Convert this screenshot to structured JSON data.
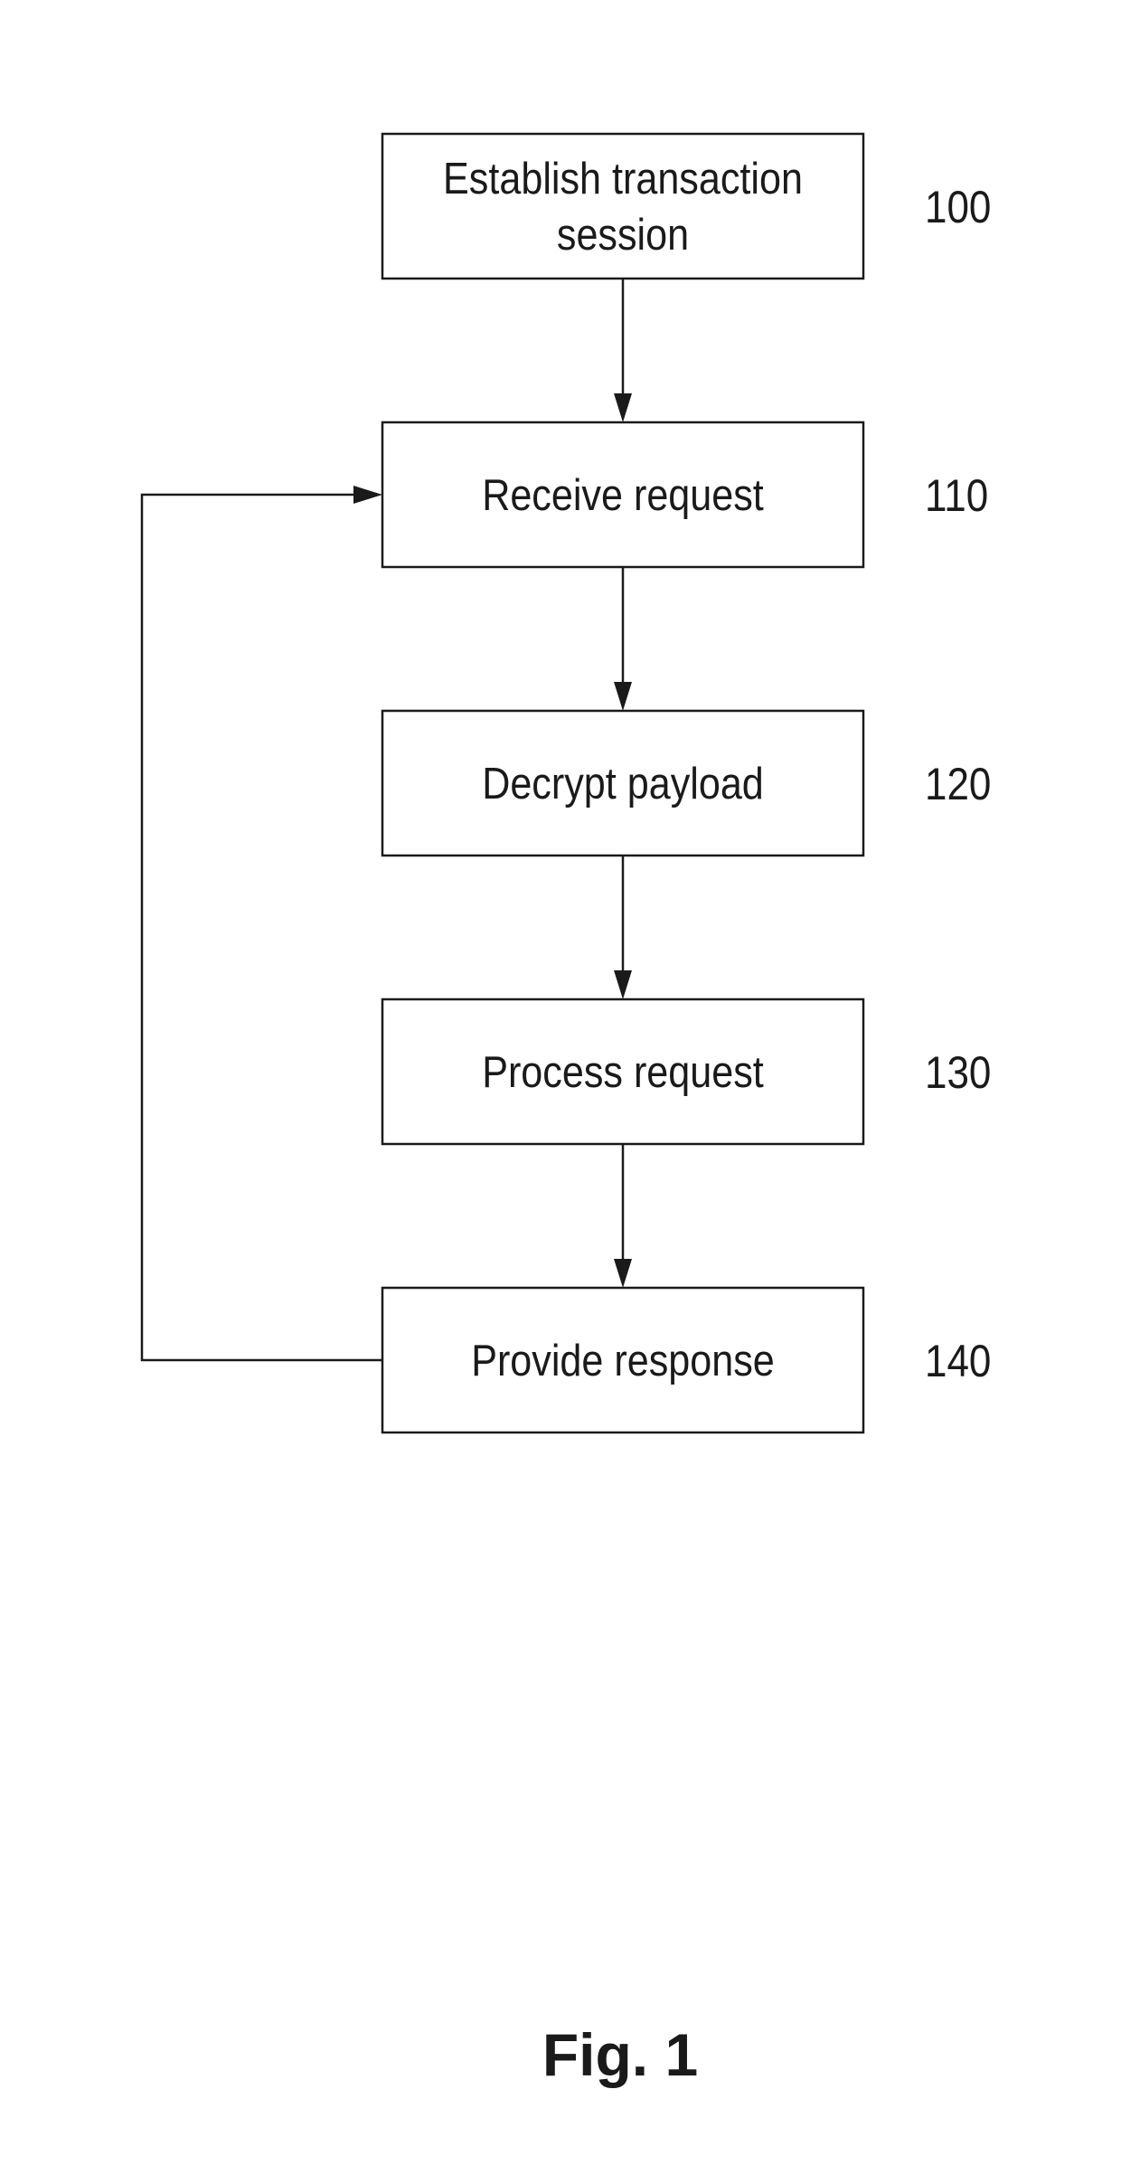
{
  "figure": {
    "caption": "Fig. 1",
    "line_color": "#1a1a1a",
    "steps": [
      {
        "ref": "100",
        "lines": [
          "Establish transaction",
          "session"
        ]
      },
      {
        "ref": "110",
        "lines": [
          "Receive request"
        ]
      },
      {
        "ref": "120",
        "lines": [
          "Decrypt payload"
        ]
      },
      {
        "ref": "130",
        "lines": [
          "Process request"
        ]
      },
      {
        "ref": "140",
        "lines": [
          "Provide response"
        ]
      }
    ],
    "connections": [
      {
        "from": "100",
        "to": "110",
        "type": "arrow"
      },
      {
        "from": "110",
        "to": "120",
        "type": "arrow"
      },
      {
        "from": "120",
        "to": "130",
        "type": "arrow"
      },
      {
        "from": "130",
        "to": "140",
        "type": "arrow"
      },
      {
        "from": "140",
        "to": "110",
        "type": "feedback-loop"
      }
    ]
  }
}
